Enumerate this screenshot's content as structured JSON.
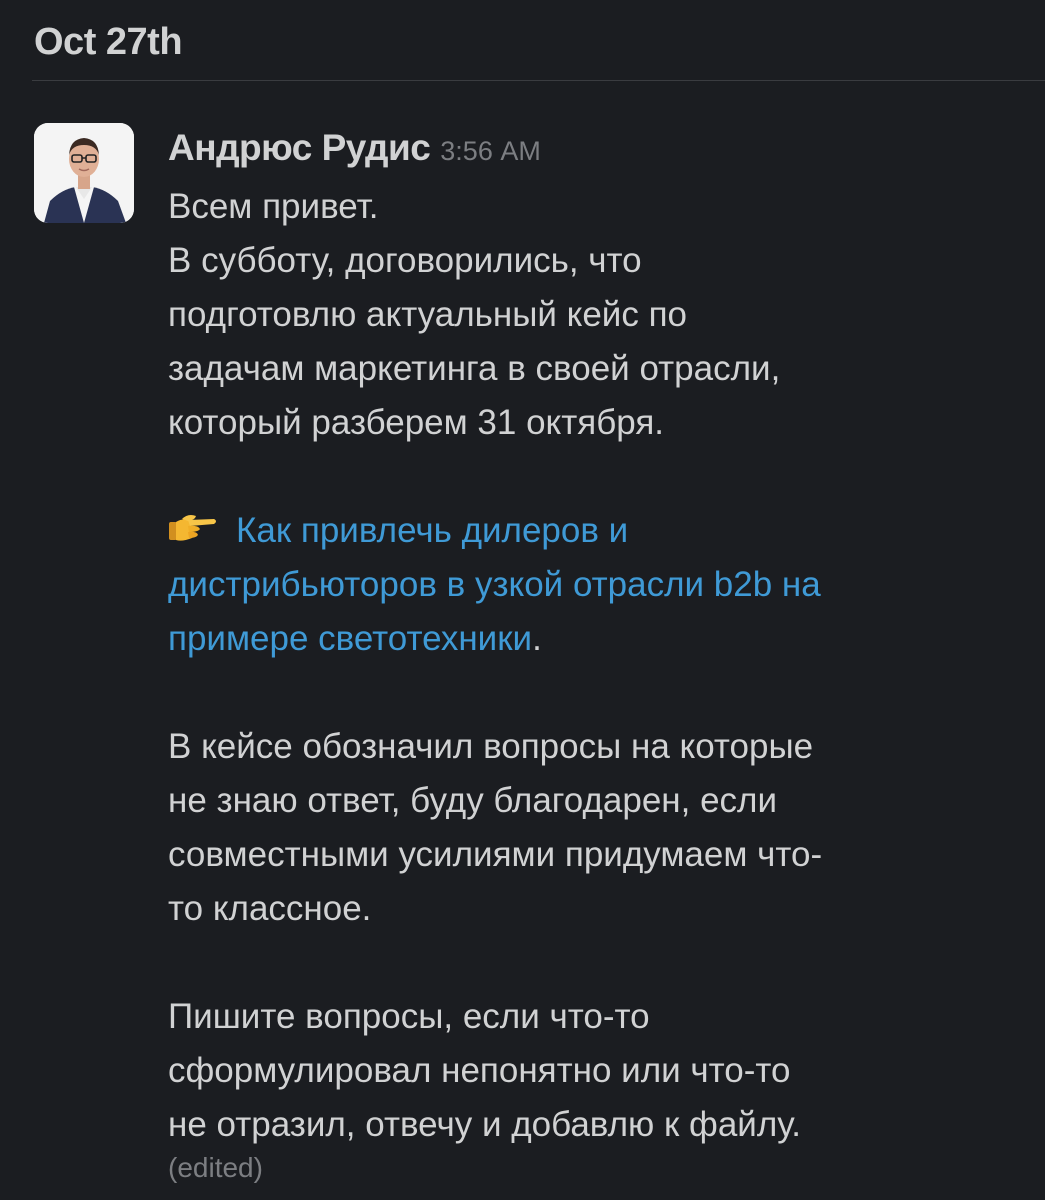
{
  "channel": {
    "date_label": "Oct 27th"
  },
  "message": {
    "author": "Андрюс Рудис",
    "time": "3:56 AM",
    "paragraph1": [
      "Всем привет.",
      "В субботу, договорились, что",
      "подготовлю актуальный кейс по",
      "задачам маркетинга в своей отрасли,",
      "который разберем 31 октября."
    ],
    "link": {
      "emoji": "pointing-right-icon",
      "line1": "Как привлечь дилеров и",
      "line2": "дистрибьюторов в узкой отрасли b2b на",
      "line3": "примере светотехники",
      "trailing": "."
    },
    "paragraph2": [
      "В кейсе обозначил вопросы на которые",
      "не знаю ответ, буду благодарен, если",
      "совместными усилиями придумаем что-",
      "то классное."
    ],
    "paragraph3": [
      "Пишите вопросы, если что-то",
      "сформулировал непонятно или что-то",
      "не отразил, отвечу и добавлю к файлу."
    ],
    "edited_label": "(edited)"
  },
  "colors": {
    "background": "#1b1d21",
    "text": "#d1d2d3",
    "muted": "#7c7e82",
    "link": "#3f9ad6"
  }
}
